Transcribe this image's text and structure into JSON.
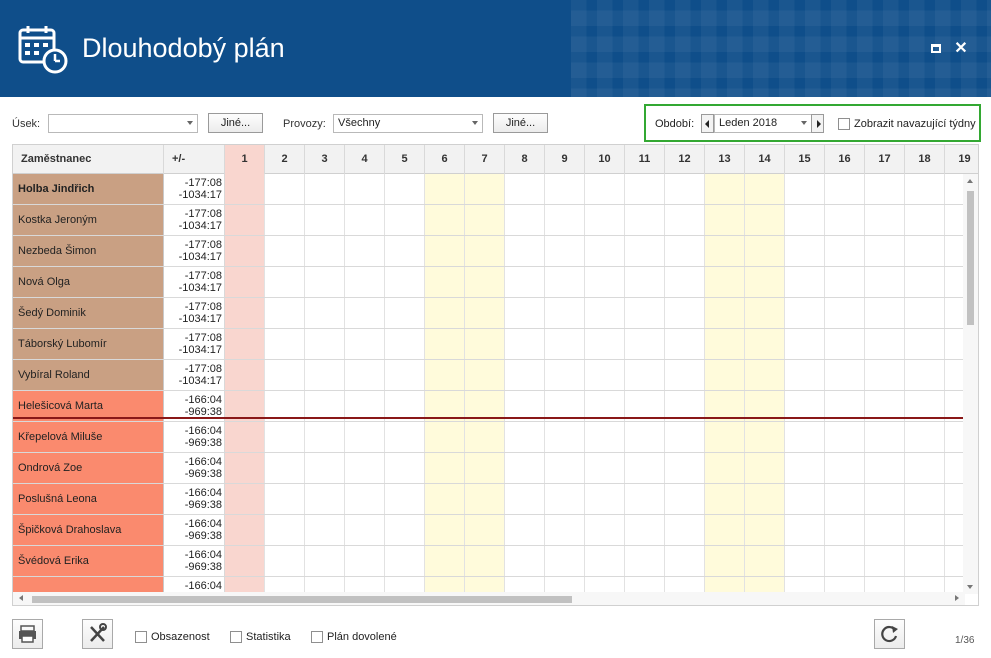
{
  "window": {
    "title": "Dlouhodobý plán"
  },
  "toolbar": {
    "usek_label": "Úsek:",
    "usek_value": "",
    "usek_other": "Jiné...",
    "provozy_label": "Provozy:",
    "provozy_value": "Všechny",
    "provozy_other": "Jiné...",
    "obdobi_label": "Období:",
    "obdobi_value": "Leden 2018",
    "show_next_weeks_label": "Zobrazit navazující týdny"
  },
  "grid": {
    "col_employee": "Zaměstnanec",
    "col_diff": "+/-",
    "days": [
      "1",
      "2",
      "3",
      "4",
      "5",
      "6",
      "7",
      "8",
      "9",
      "10",
      "11",
      "12",
      "13",
      "14",
      "15",
      "16",
      "17",
      "18",
      "19"
    ],
    "weekend_days": [
      6,
      7,
      13,
      14
    ],
    "holiday_days": [
      1
    ],
    "rows": [
      {
        "name": "Holba Jindřich",
        "bold": true,
        "v1": "-177:08",
        "v2": "-1034:17",
        "group": "a"
      },
      {
        "name": "Kostka Jeroným",
        "v1": "-177:08",
        "v2": "-1034:17",
        "group": "a"
      },
      {
        "name": "Nezbeda Šimon",
        "v1": "-177:08",
        "v2": "-1034:17",
        "group": "a"
      },
      {
        "name": "Nová Olga",
        "v1": "-177:08",
        "v2": "-1034:17",
        "group": "a"
      },
      {
        "name": "Šedý Dominik",
        "v1": "-177:08",
        "v2": "-1034:17",
        "group": "a"
      },
      {
        "name": "Táborský Lubomír",
        "v1": "-177:08",
        "v2": "-1034:17",
        "group": "a"
      },
      {
        "name": "Vybíral Roland",
        "v1": "-177:08",
        "v2": "-1034:17",
        "group": "a"
      },
      {
        "name": "Helešicová Marta",
        "v1": "-166:04",
        "v2": "-969:38",
        "group": "b"
      },
      {
        "name": "Křepelová Miluše",
        "v1": "-166:04",
        "v2": "-969:38",
        "group": "b"
      },
      {
        "name": "Ondrová Zoe",
        "v1": "-166:04",
        "v2": "-969:38",
        "group": "b"
      },
      {
        "name": "Poslušná Leona",
        "v1": "-166:04",
        "v2": "-969:38",
        "group": "b"
      },
      {
        "name": "Špičková Drahoslava",
        "v1": "-166:04",
        "v2": "-969:38",
        "group": "b"
      },
      {
        "name": "Švédová Erika",
        "v1": "-166:04",
        "v2": "-969:38",
        "group": "b"
      },
      {
        "name": "",
        "v1": "-166:04",
        "v2": "",
        "group": "b"
      }
    ]
  },
  "colors": {
    "group_a": "#c9a083",
    "group_b": "#fa8a6e",
    "weekend": "#fffbdb",
    "holiday": "#f9d6cf"
  },
  "bottom": {
    "occupancy_label": "Obsazenost",
    "statistics_label": "Statistika",
    "vacation_label": "Plán dovolené",
    "pager": "1/36"
  }
}
